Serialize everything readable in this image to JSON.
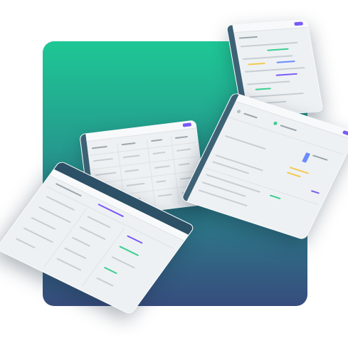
{
  "illustration": {
    "backdrop_gradient": [
      "#1ec795",
      "#374c7d"
    ],
    "card_accent_color": "#7a5af8",
    "card_sidebar_color": "#3d6275",
    "cards": [
      {
        "id": "card-a",
        "kind": "dashboard-preview"
      },
      {
        "id": "card-b",
        "kind": "dashboard-preview"
      },
      {
        "id": "card-c",
        "kind": "dashboard-preview"
      },
      {
        "id": "card-d",
        "kind": "dashboard-preview"
      }
    ]
  }
}
